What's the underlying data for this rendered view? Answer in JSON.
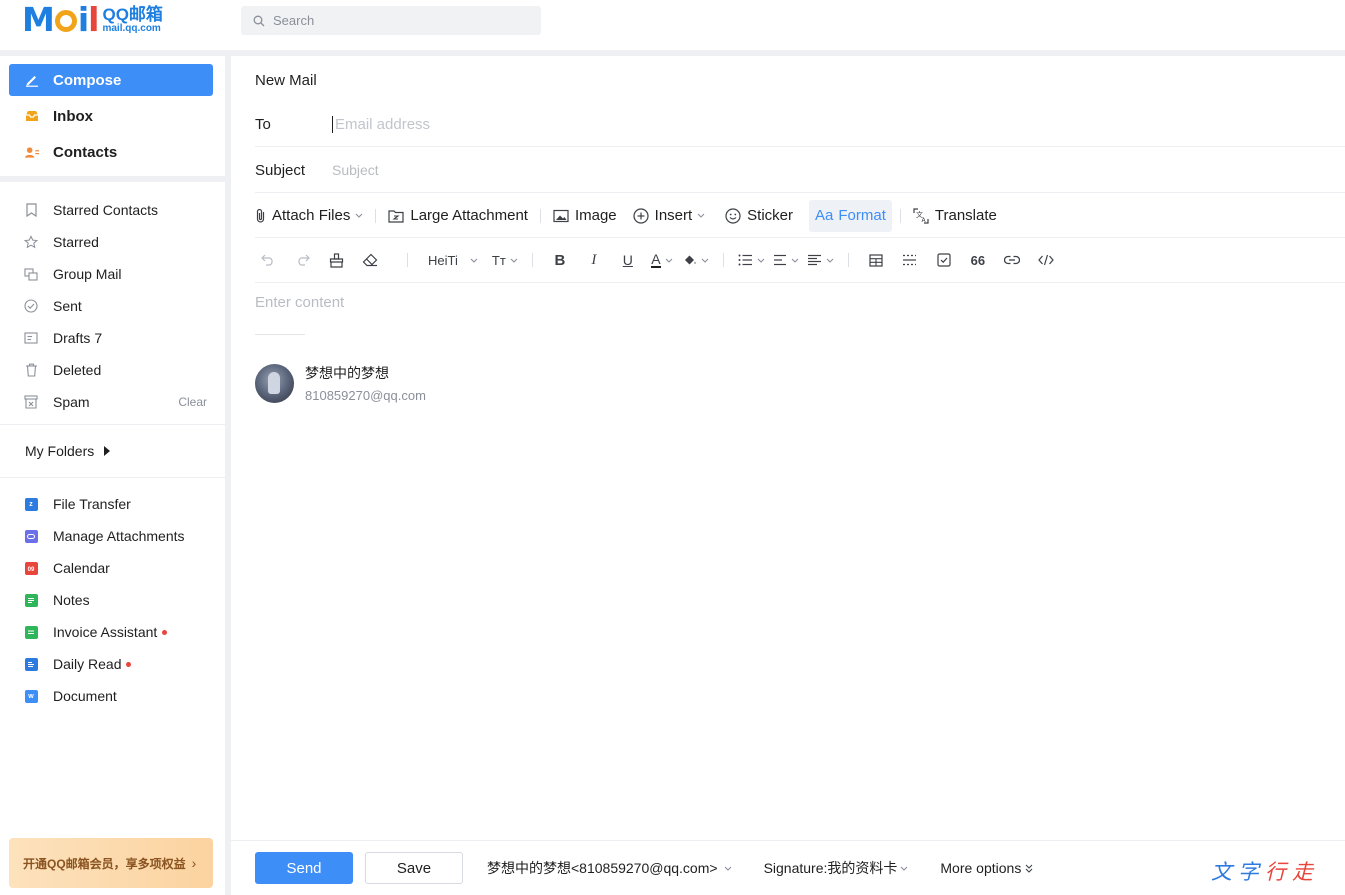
{
  "app": {
    "logo_word": [
      "M",
      "",
      "i",
      "l"
    ],
    "logo_cn": "QQ邮箱",
    "logo_url": "mail.qq.com"
  },
  "search": {
    "placeholder": "Search"
  },
  "sidebar": {
    "primary": [
      {
        "label": "Compose",
        "icon": "pencil-icon",
        "active": true
      },
      {
        "label": "Inbox",
        "icon": "inbox-icon",
        "active": false
      },
      {
        "label": "Contacts",
        "icon": "contacts-icon",
        "active": false
      }
    ],
    "mail_items": [
      {
        "label": "Starred Contacts",
        "icon": "bookmark-icon"
      },
      {
        "label": "Starred",
        "icon": "star-icon"
      },
      {
        "label": "Group Mail",
        "icon": "group-mail-icon"
      },
      {
        "label": "Sent",
        "icon": "check-circle-icon"
      },
      {
        "label": "Drafts",
        "count": "7",
        "icon": "drafts-icon"
      },
      {
        "label": "Deleted",
        "icon": "trash-icon"
      },
      {
        "label": "Spam",
        "action": "Clear",
        "icon": "spam-icon"
      }
    ],
    "folders_label": "My Folders",
    "apps": [
      {
        "label": "File Transfer",
        "icon": "file-transfer-icon",
        "color": "#2e7be0",
        "badge": "z"
      },
      {
        "label": "Manage Attachments",
        "icon": "attachments-icon",
        "color": "#6b6fe8",
        "badge": ""
      },
      {
        "label": "Calendar",
        "icon": "calendar-icon",
        "color": "#e8453c",
        "badge": "09"
      },
      {
        "label": "Notes",
        "icon": "notes-icon",
        "color": "#2fb55a",
        "badge": ""
      },
      {
        "label": "Invoice Assistant",
        "icon": "invoice-icon",
        "color": "#2fb55a",
        "badge": "",
        "dot": true
      },
      {
        "label": "Daily Read",
        "icon": "daily-read-icon",
        "color": "#2e7be0",
        "badge": "",
        "dot": true
      },
      {
        "label": "Document",
        "icon": "document-icon",
        "color": "#3e8ef7",
        "badge": "w"
      }
    ],
    "vip_label": "开通QQ邮箱会员，享多项权益",
    "vip_arrow": "›"
  },
  "compose": {
    "title": "New Mail",
    "to_label": "To",
    "to_placeholder": "Email address",
    "subject_label": "Subject",
    "subject_placeholder": "Subject",
    "toolbar": {
      "attach": "Attach Files",
      "large_attachment": "Large Attachment",
      "image": "Image",
      "insert": "Insert",
      "sticker": "Sticker",
      "format": "Format",
      "format_prefix": "Aa",
      "translate": "Translate"
    },
    "format_bar": {
      "font": "HeiTi",
      "font_size": "Tт",
      "bold": "B",
      "italic": "I",
      "underline": "U",
      "text_color": "A",
      "quote": "66"
    },
    "content_placeholder": "Enter content",
    "card": {
      "name": "梦想中的梦想",
      "email": "810859270@qq.com"
    }
  },
  "footer": {
    "send": "Send",
    "save": "Save",
    "sender": "梦想中的梦想<810859270@qq.com>",
    "signature": "Signature:我的资料卡",
    "more": "More options",
    "watermark_1": "文字",
    "watermark_2": "行走"
  },
  "colors": {
    "accent": "#3e8ef7",
    "badge_dot": "#e8453c"
  }
}
